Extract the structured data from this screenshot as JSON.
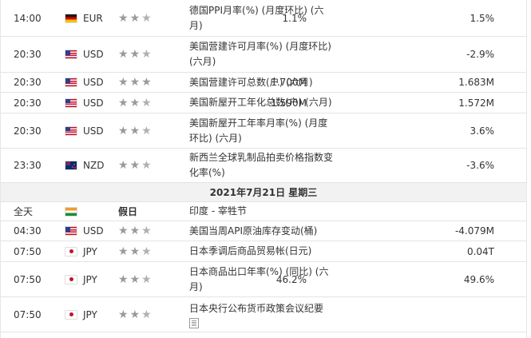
{
  "rows_top": [
    {
      "time": "14:00",
      "flag": "de",
      "currency": "EUR",
      "stars": 2,
      "event": "德国PPI月率(%) (月度环比) (六月)",
      "actual": "1.1%",
      "previous": "1.5%"
    },
    {
      "time": "20:30",
      "flag": "us",
      "currency": "USD",
      "stars": 2,
      "event": "美国营建许可月率(%) (月度环比) (六月)",
      "actual": "",
      "previous": "-2.9%"
    },
    {
      "time": "20:30",
      "flag": "us",
      "currency": "USD",
      "stars": 3,
      "event": "美国营建许可总数(户) (六月)",
      "actual": "1.700M",
      "previous": "1.683M"
    },
    {
      "time": "20:30",
      "flag": "us",
      "currency": "USD",
      "stars": 2,
      "event": "美国新屋开工年化总数(户) (六月)",
      "actual": "1.590M",
      "previous": "1.572M"
    },
    {
      "time": "20:30",
      "flag": "us",
      "currency": "USD",
      "stars": 2,
      "event": "美国新屋开工年率月率(%) (月度环比) (六月)",
      "actual": "",
      "previous": "3.6%"
    },
    {
      "time": "23:30",
      "flag": "nz",
      "currency": "NZD",
      "stars": 2,
      "event": "新西兰全球乳制品拍卖价格指数变化率(%)",
      "actual": "",
      "previous": "-3.6%"
    }
  ],
  "date_header": "2021年7月21日  星期三",
  "holiday": {
    "time": "全天",
    "flag": "in",
    "label": "假日",
    "event": "印度 - 宰牲节"
  },
  "rows_bottom": [
    {
      "time": "04:30",
      "flag": "us",
      "currency": "USD",
      "stars": 2,
      "event": "美国当周API原油库存变动(桶)",
      "actual": "",
      "previous": "-4.079M"
    },
    {
      "time": "07:50",
      "flag": "jp",
      "currency": "JPY",
      "stars": 2,
      "event": "日本季调后商品贸易帐(日元)",
      "actual": "",
      "previous": "0.04T"
    },
    {
      "time": "07:50",
      "flag": "jp",
      "currency": "JPY",
      "stars": 2,
      "event": "日本商品出口年率(%) (同比) (六月)",
      "actual": "46.2%",
      "previous": "49.6%"
    },
    {
      "time": "07:50",
      "flag": "jp",
      "currency": "JPY",
      "stars": 2,
      "event": "日本央行公布货币政策会议纪要",
      "actual": "",
      "previous": ""
    }
  ]
}
